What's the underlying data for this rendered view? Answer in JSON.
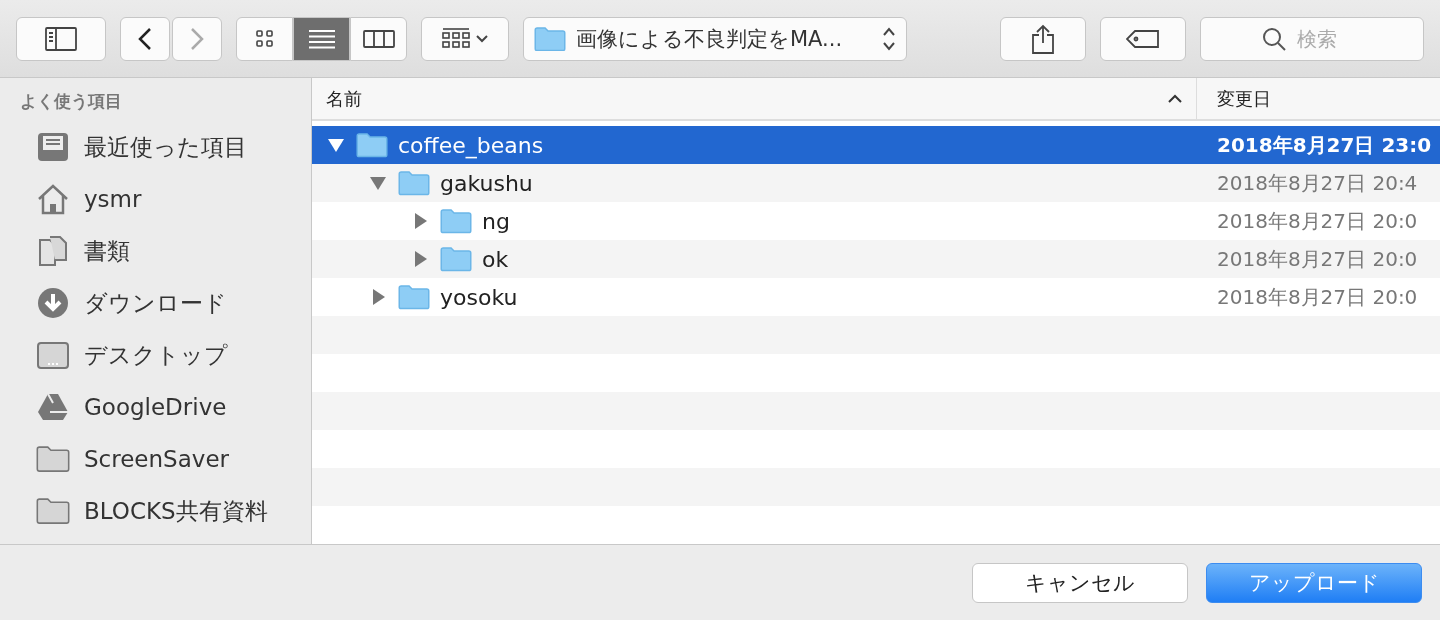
{
  "toolbar": {
    "view_buttons": [
      {
        "kind": "icons",
        "selected": false
      },
      {
        "kind": "list",
        "selected": true
      },
      {
        "kind": "columns",
        "selected": false
      }
    ],
    "path": "画像による不良判定をMA...",
    "search": {
      "placeholder": "検索"
    }
  },
  "sidebar": {
    "heading": "よく使う項目",
    "items": [
      {
        "label": "最近使った項目",
        "kind": "recents"
      },
      {
        "label": "ysmr",
        "kind": "home"
      },
      {
        "label": "書類",
        "kind": "documents"
      },
      {
        "label": "ダウンロード",
        "kind": "downloads"
      },
      {
        "label": "デスクトップ",
        "kind": "desktop"
      },
      {
        "label": "GoogleDrive",
        "kind": "drive"
      },
      {
        "label": "ScreenSaver",
        "kind": "folder"
      },
      {
        "label": "BLOCKS共有資料",
        "kind": "folder"
      }
    ]
  },
  "table": {
    "columns": [
      {
        "label": "名前",
        "sorted": true
      },
      {
        "label": "変更日",
        "sorted": false
      }
    ],
    "rows": [
      {
        "name": "coffee_beans",
        "date": "2018年8月27日 23:0",
        "selected": true,
        "expanded": true,
        "children": [
          {
            "name": "gakushu",
            "date": "2018年8月27日 20:4",
            "selected": false,
            "expanded": true,
            "children": [
              {
                "name": "ng",
                "date": "2018年8月27日 20:0",
                "selected": false,
                "expanded": false
              },
              {
                "name": "ok",
                "date": "2018年8月27日 20:0",
                "selected": false,
                "expanded": false
              }
            ]
          },
          {
            "name": "yosoku",
            "date": "2018年8月27日 20:0",
            "selected": false,
            "expanded": false
          }
        ]
      }
    ]
  },
  "buttons": [
    {
      "label": "キャンセル",
      "primary": false
    },
    {
      "label": "アップロード",
      "primary": true
    }
  ]
}
